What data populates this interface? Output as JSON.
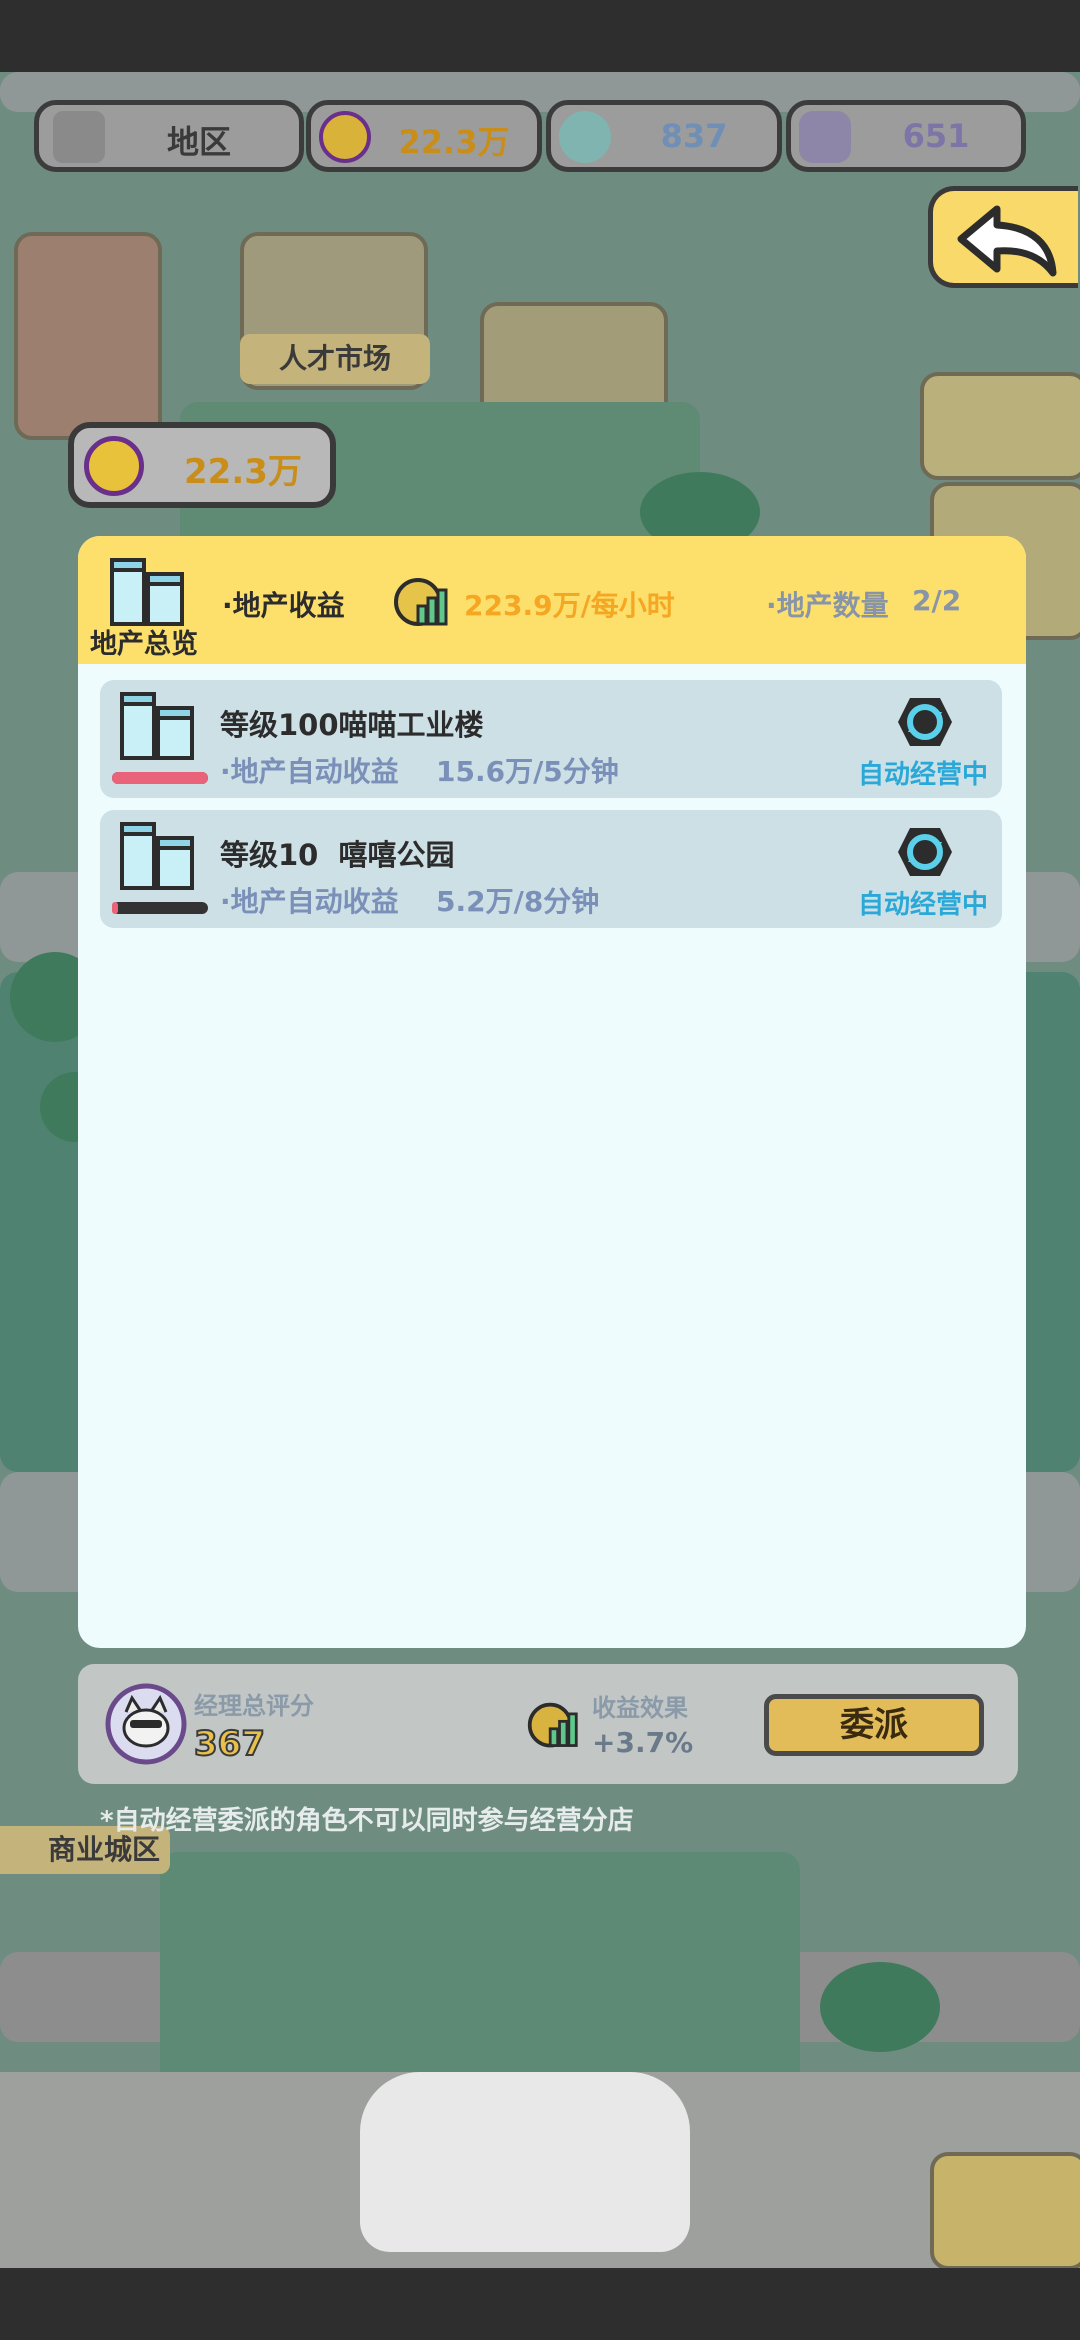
{
  "topbar": {
    "region_label": "地区",
    "coins": "22.3万",
    "gems_a": "837",
    "gems_b": "651"
  },
  "map_labels": {
    "talent_market": "人才市场",
    "commercial_zone": "商业城区"
  },
  "coin_pill": {
    "value": "22.3万"
  },
  "panel": {
    "title": "地产总览",
    "income_label": "·地产收益",
    "income_value": "223.9万/每小时",
    "count_label": "·地产数量",
    "count_value": "2/2",
    "properties": [
      {
        "name": "等级100喵喵工业楼",
        "sub_label": "·地产自动收益",
        "sub_value": "15.6万/5分钟",
        "status": "自动经营中",
        "progress": 1.0,
        "bar_color": "#e9637a"
      },
      {
        "name": "等级10  嘻嘻公园",
        "sub_label": "·地产自动收益",
        "sub_value": "5.2万/8分钟",
        "status": "自动经营中",
        "progress": 0.06,
        "bar_color": "#e9637a"
      }
    ]
  },
  "manager": {
    "score_label": "经理总评分",
    "score_value": "367",
    "effect_label": "收益效果",
    "effect_value": "+3.7%",
    "assign_label": "委派"
  },
  "note": "*自动经营委派的角色不可以同时参与经营分店",
  "colors": {
    "panel_header": "#fde06c",
    "panel_body": "#effcfd",
    "accent_blue": "#2aa8d8",
    "income_orange": "#f5a623"
  }
}
